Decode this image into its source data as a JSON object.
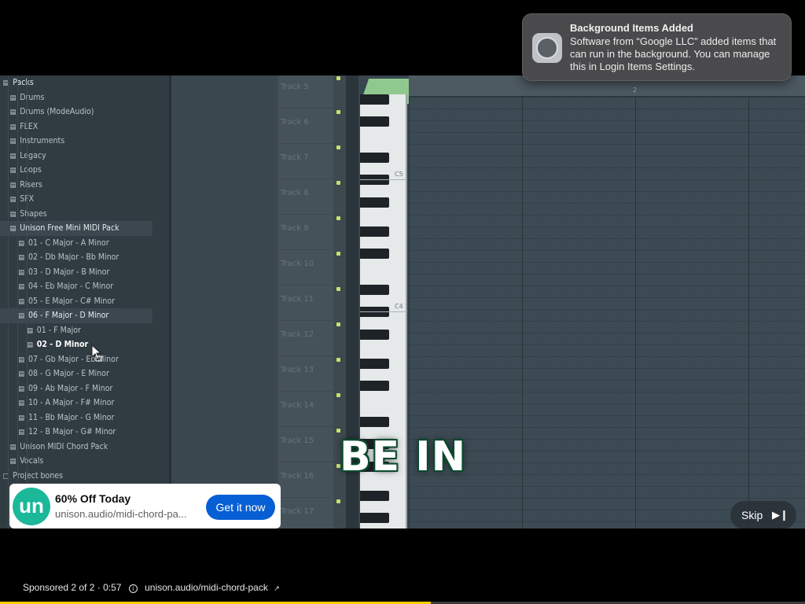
{
  "notification": {
    "title": "Background Items Added",
    "body": "Software from “Google LLC” added items that can run in the background. You can manage this in Login Items Settings.",
    "icon": "settings-gear-icon"
  },
  "browser": {
    "items": [
      {
        "label": "Packs",
        "level": 0,
        "open": true
      },
      {
        "label": "Drums",
        "level": 1
      },
      {
        "label": "Drums (ModeAudio)",
        "level": 1
      },
      {
        "label": "FLEX",
        "level": 1
      },
      {
        "label": "Instruments",
        "level": 1
      },
      {
        "label": "Legacy",
        "level": 1
      },
      {
        "label": "Loops",
        "level": 1
      },
      {
        "label": "Risers",
        "level": 1
      },
      {
        "label": "SFX",
        "level": 1
      },
      {
        "label": "Shapes",
        "level": 1
      },
      {
        "label": "Unison Free Mini MIDI Pack",
        "level": 1,
        "open": true
      },
      {
        "label": "01 - C Major - A Minor",
        "level": 2
      },
      {
        "label": "02 - Db Major - Bb Minor",
        "level": 2
      },
      {
        "label": "03 - D Major - B Minor",
        "level": 2
      },
      {
        "label": "04 - Eb Major - C Minor",
        "level": 2
      },
      {
        "label": "05 - E Major - C# Minor",
        "level": 2
      },
      {
        "label": "06 - F Major - D Minor",
        "level": 2,
        "open": true
      },
      {
        "label": "01 - F Major",
        "level": 3
      },
      {
        "label": "02 - D Minor",
        "level": 3,
        "active": true
      },
      {
        "label": "07 - Gb Major - Eb Minor",
        "level": 2
      },
      {
        "label": "08 - G Major - E Minor",
        "level": 2
      },
      {
        "label": "09 - Ab Major - F Minor",
        "level": 2
      },
      {
        "label": "10 - A Major - F# Minor",
        "level": 2
      },
      {
        "label": "11 - Bb Major - G Minor",
        "level": 2
      },
      {
        "label": "12 - B Major - G# Minor",
        "level": 2
      },
      {
        "label": "Unison MIDI Chord Pack",
        "level": 1
      },
      {
        "label": "Vocals",
        "level": 1
      },
      {
        "label": "Project bones",
        "level": 0
      }
    ]
  },
  "rack": {
    "tracks": [
      "Track 5",
      "Track 6",
      "Track 7",
      "Track 8",
      "Track 9",
      "Track 10",
      "Track 11",
      "Track 12",
      "Track 13",
      "Track 14",
      "Track 15",
      "Track 16",
      "Track 17"
    ]
  },
  "piano": {
    "labels": [
      "C5",
      "C4"
    ],
    "bar_number": "2"
  },
  "caption": "BE IN",
  "ad": {
    "title": "60% Off Today",
    "url": "unison.audio/midi-chord-pa...",
    "cta": "Get it now",
    "logo_letter": "un",
    "brand_color": "#1bb89a",
    "cta_color": "#065fd4"
  },
  "skip": {
    "label": "Skip",
    "icon": "skip-next-icon"
  },
  "ad_info": {
    "sponsored": "Sponsored 2 of 2 · 0:57",
    "info_icon": "info-icon",
    "link": "unison.audio/midi-chord-pack",
    "external_icon": "external-link-icon"
  },
  "progress": {
    "fraction": 0.535,
    "color": "#ffcc00"
  }
}
